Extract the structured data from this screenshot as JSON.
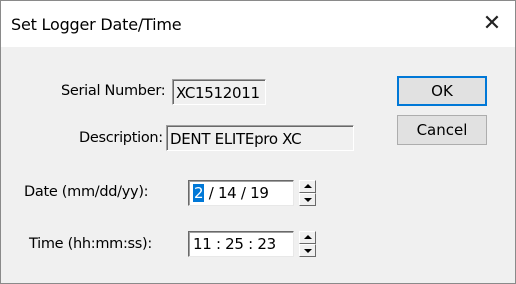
{
  "window": {
    "title": "Set Logger Date/Time",
    "close_glyph": "✕"
  },
  "serial": {
    "label": "Serial Number:",
    "value": "XC1512011"
  },
  "description": {
    "label": "Description:",
    "value": "DENT ELITEpro XC"
  },
  "date": {
    "label": "Date (mm/dd/yy):",
    "selected": "2",
    "rest": "/ 14 / 19"
  },
  "time": {
    "label": "Time (hh:mm:ss):",
    "value": "11 : 25 : 23"
  },
  "buttons": {
    "ok": "OK",
    "cancel": "Cancel"
  },
  "colors": {
    "accent": "#0078d7",
    "dialog_bg": "#f0f0f0"
  }
}
